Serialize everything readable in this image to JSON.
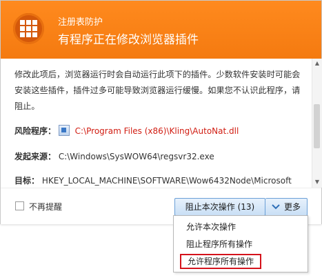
{
  "header": {
    "title": "注册表防护",
    "subtitle": "有程序正在修改浏览器插件"
  },
  "content": {
    "description": "修改此项后，浏览器运行时会自动运行此项下的插件。少数软件安装时可能会安装这些插件，插件过多可能导致浏览器运行缓慢。如果您不认识此程序，请阻止。",
    "risk_label": "风险程序：",
    "risk_value": "C:\\Program Files (x86)\\Kling\\AutoNat.dll",
    "source_label": "发起来源：",
    "source_value": "C:\\Windows\\SysWOW64\\regsvr32.exe",
    "target_label": "目标：",
    "target_value": "HKEY_LOCAL_MACHINE\\SOFTWARE\\Wow6432Node\\Microsoft"
  },
  "footer": {
    "checkbox_label": "不再提醒",
    "block_button": "阻止本次操作 (13)",
    "more_button": "更多"
  },
  "menu": {
    "items": [
      "允许本次操作",
      "阻止程序所有操作",
      "允许程序所有操作"
    ]
  },
  "colors": {
    "header_orange": "#f47a10",
    "risk_red": "#d11d12",
    "highlight_border": "#d4121b",
    "button_blue": "#6a9fd6"
  },
  "icons": [
    "grid-shield-icon",
    "file-icon",
    "chevron-down-icon",
    "close-icon"
  ]
}
